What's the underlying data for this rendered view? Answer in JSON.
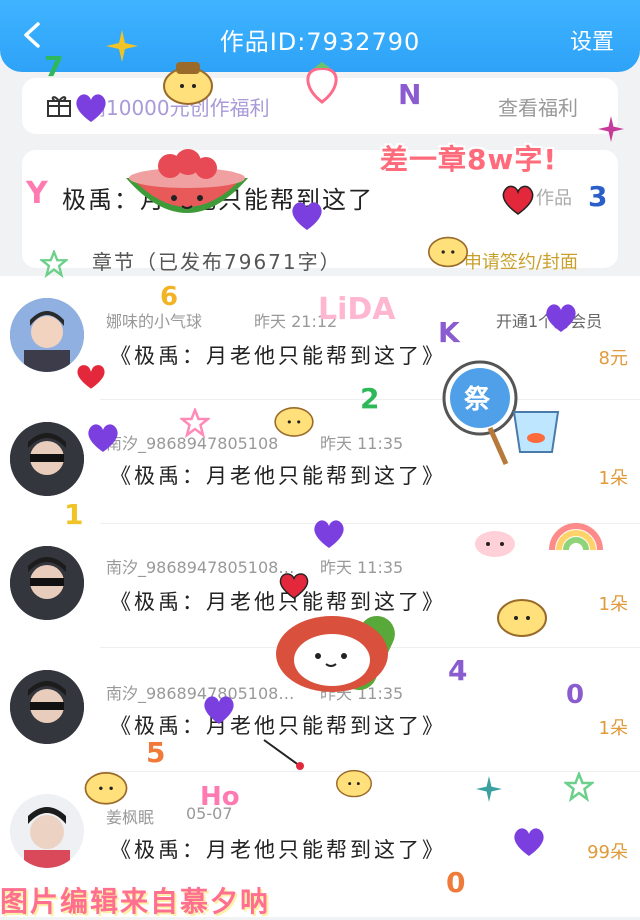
{
  "header": {
    "title": "作品ID:7932790",
    "settings_label": "设置"
  },
  "promo": {
    "text": "高10000元创作福利",
    "link": "查看福利"
  },
  "work": {
    "title": "极禹：月老他只能帮到这了",
    "link": "作品",
    "chapter": "章节（已发布79671字）",
    "sign_link": "申请签约/封面"
  },
  "rows": [
    {
      "username": "娜味的小气球",
      "time": "昨天 21:12",
      "extra": "开通1个月会员",
      "comment": "《极禹：月老他只能帮到这了》",
      "amount": "8元"
    },
    {
      "username": "南汐_9868947805108",
      "time": "昨天 11:35",
      "extra": "",
      "comment": "《极禹：月老他只能帮到这了》",
      "amount": "1朵"
    },
    {
      "username": "南汐_9868947805108…",
      "time": "昨天 11:35",
      "extra": "",
      "comment": "《极禹：月老他只能帮到这了》",
      "amount": "1朵"
    },
    {
      "username": "南汐_9868947805108…",
      "time": "昨天 11:35",
      "extra": "",
      "comment": "《极禹：月老他只能帮到这了》",
      "amount": "1朵"
    },
    {
      "username": "姜枫眠",
      "time": "05-07",
      "extra": "",
      "comment": "《极禹：月老他只能帮到这了》",
      "amount": "99朵"
    }
  ],
  "stickers": {
    "headline": "差一章8w字!",
    "credit": "图片编辑来自慕夕呐",
    "letters": [
      "7",
      "N",
      "Y",
      "3",
      "6",
      "K",
      "2",
      "1",
      "4",
      "0",
      "5",
      "0"
    ],
    "brand": "LiDA",
    "ho": "Ho"
  },
  "colors": {
    "header_blue": "#2ea2f7",
    "accent_purple": "#7b3fe0",
    "amount_orange": "#e09a3a"
  }
}
